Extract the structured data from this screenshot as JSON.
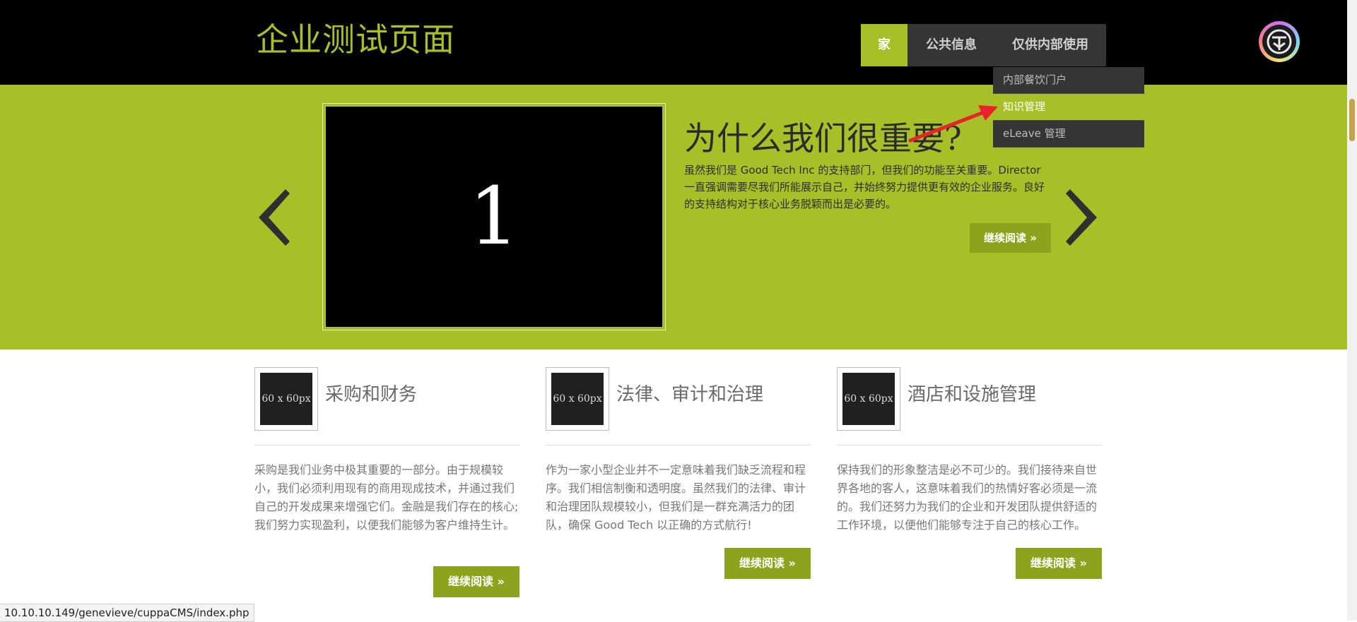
{
  "header": {
    "site_title": "企业测试页面",
    "nav": [
      {
        "label": "家",
        "active": true
      },
      {
        "label": "公共信息",
        "active": false
      },
      {
        "label": "仅供内部使用",
        "active": false
      }
    ],
    "dropdown": [
      {
        "label": "内部餐饮门户",
        "highlighted": false
      },
      {
        "label": "知识管理",
        "highlighted": true
      },
      {
        "label": "eLeave 管理",
        "highlighted": false
      }
    ]
  },
  "hero": {
    "slide_number": "1",
    "title": "为什么我们很重要?",
    "text": "虽然我们是 Good Tech Inc 的支持部门，但我们的功能至关重要。Director 一直强调需要尽我们所能展示自己，并始终努力提供更有效的企业服务。良好的支持结构对于核心业务脱颖而出是必要的。",
    "read_more": "继续阅读 »"
  },
  "columns": [
    {
      "thumb": "60 x 60px",
      "title": "采购和财务",
      "text": "采购是我们业务中极其重要的一部分。由于规模较小，我们必须利用现有的商用现成技术，并通过我们自己的开发成果来增强它们。金融是我们存在的核心;我们努力实现盈利，以便我们能够为客户维持生计。",
      "read_more": "继续阅读 »"
    },
    {
      "thumb": "60 x 60px",
      "title": "法律、审计和治理",
      "text": "作为一家小型企业并不一定意味着我们缺乏流程和程序。我们相信制衡和透明度。虽然我们的法律、审计和治理团队规模较小，但我们是一群充满活力的团队，确保 Good Tech 以正确的方式航行!",
      "read_more": "继续阅读 »"
    },
    {
      "thumb": "60 x 60px",
      "title": "酒店和设施管理",
      "text": "保持我们的形象整洁是必不可少的。我们接待来自世界各地的客人，这意味着我们的热情好客必须是一流的。我们还努力为我们的企业和开发团队提供舒适的工作环境，以便他们能够专注于自己的核心工作。",
      "read_more": "继续阅读 »"
    }
  ],
  "status_url": "10.10.10.149/genevieve/cuppaCMS/index.php",
  "colors": {
    "accent": "#a7c027",
    "button": "#8ea31d",
    "header_bg": "#000000",
    "nav_bg": "#353535",
    "annotation": "#e8232b"
  },
  "icons": [
    "chevron-left-icon",
    "chevron-right-icon",
    "app-logo-icon",
    "annotation-arrow-icon"
  ]
}
